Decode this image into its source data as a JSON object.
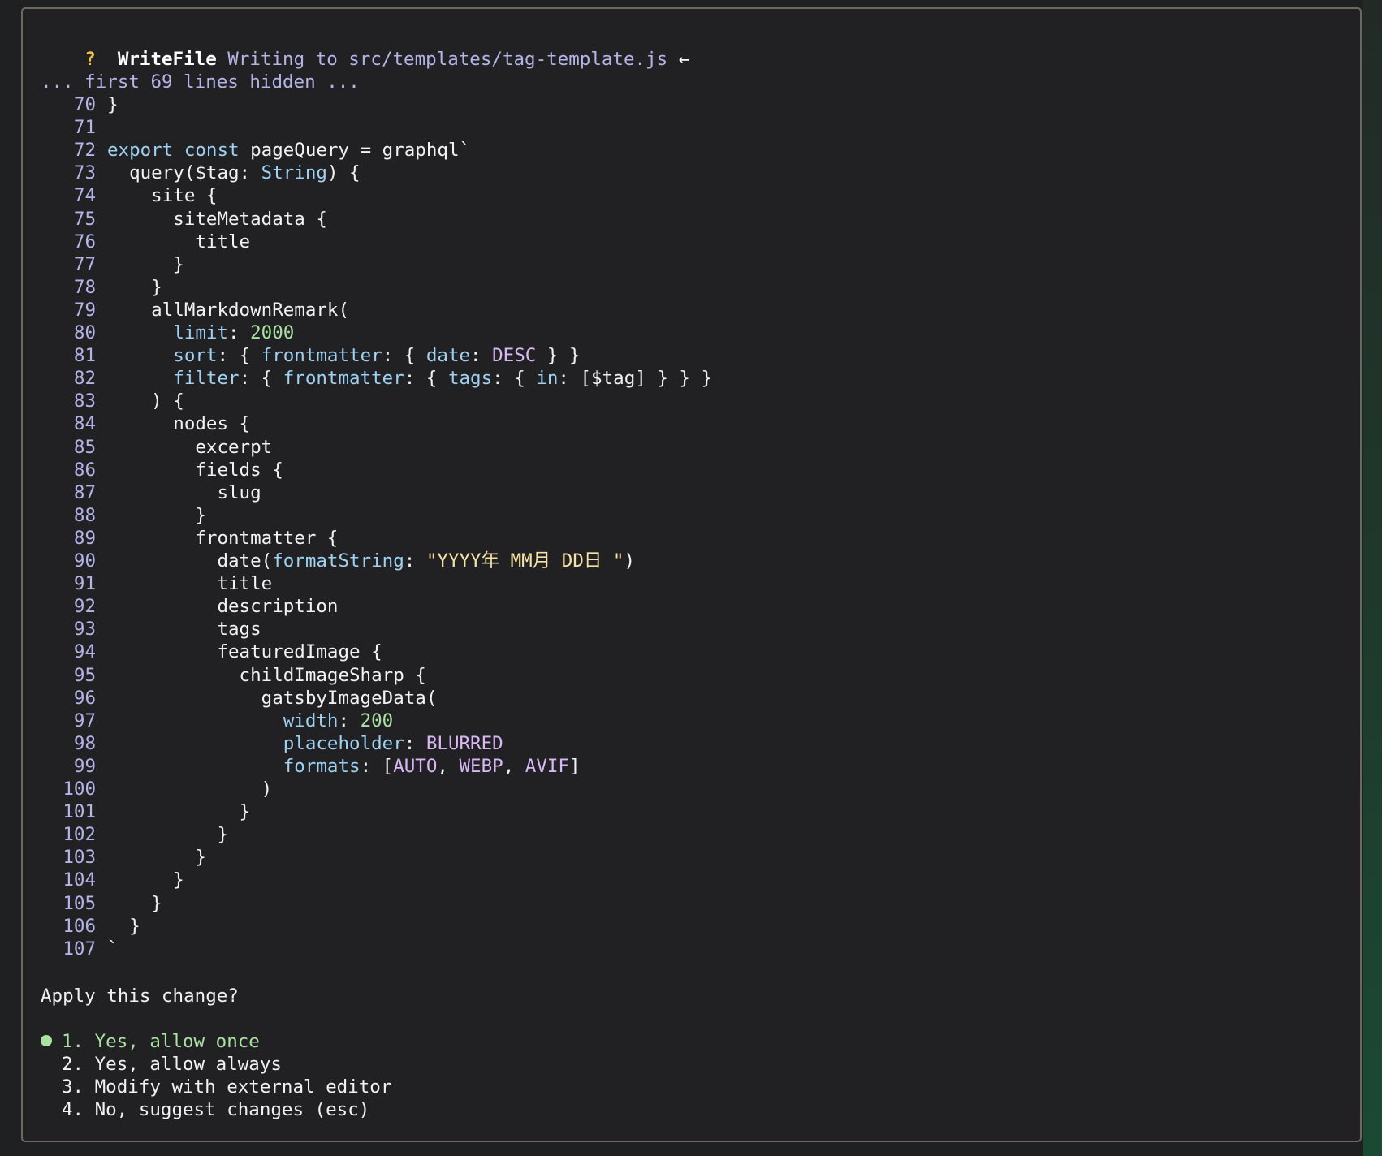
{
  "header": {
    "question_mark": "?",
    "tool_name": "WriteFile",
    "description": "Writing to src/templates/tag-template.js",
    "arrow": "←"
  },
  "hidden_note": "... first 69 lines hidden ...",
  "code": {
    "lines": [
      {
        "n": "70",
        "tokens": [
          {
            "t": "}",
            "c": "default"
          }
        ]
      },
      {
        "n": "71",
        "tokens": []
      },
      {
        "n": "72",
        "tokens": [
          {
            "t": "export const ",
            "c": "kw"
          },
          {
            "t": "pageQuery = graphql`",
            "c": "default"
          }
        ]
      },
      {
        "n": "73",
        "tokens": [
          {
            "t": "  query($tag: ",
            "c": "default"
          },
          {
            "t": "String",
            "c": "type"
          },
          {
            "t": ") {",
            "c": "default"
          }
        ]
      },
      {
        "n": "74",
        "tokens": [
          {
            "t": "    site {",
            "c": "default"
          }
        ]
      },
      {
        "n": "75",
        "tokens": [
          {
            "t": "      siteMetadata {",
            "c": "default"
          }
        ]
      },
      {
        "n": "76",
        "tokens": [
          {
            "t": "        title",
            "c": "default"
          }
        ]
      },
      {
        "n": "77",
        "tokens": [
          {
            "t": "      }",
            "c": "default"
          }
        ]
      },
      {
        "n": "78",
        "tokens": [
          {
            "t": "    }",
            "c": "default"
          }
        ]
      },
      {
        "n": "79",
        "tokens": [
          {
            "t": "    allMarkdownRemark(",
            "c": "default"
          }
        ]
      },
      {
        "n": "80",
        "tokens": [
          {
            "t": "      ",
            "c": "default"
          },
          {
            "t": "limit",
            "c": "prop"
          },
          {
            "t": ": ",
            "c": "default"
          },
          {
            "t": "2000",
            "c": "num"
          }
        ]
      },
      {
        "n": "81",
        "tokens": [
          {
            "t": "      ",
            "c": "default"
          },
          {
            "t": "sort",
            "c": "prop"
          },
          {
            "t": ": { ",
            "c": "default"
          },
          {
            "t": "frontmatter",
            "c": "prop"
          },
          {
            "t": ": { ",
            "c": "default"
          },
          {
            "t": "date",
            "c": "prop"
          },
          {
            "t": ": ",
            "c": "default"
          },
          {
            "t": "DESC",
            "c": "enum"
          },
          {
            "t": " } }",
            "c": "default"
          }
        ]
      },
      {
        "n": "82",
        "tokens": [
          {
            "t": "      ",
            "c": "default"
          },
          {
            "t": "filter",
            "c": "prop"
          },
          {
            "t": ": { ",
            "c": "default"
          },
          {
            "t": "frontmatter",
            "c": "prop"
          },
          {
            "t": ": { ",
            "c": "default"
          },
          {
            "t": "tags",
            "c": "prop"
          },
          {
            "t": ": { ",
            "c": "default"
          },
          {
            "t": "in",
            "c": "prop"
          },
          {
            "t": ": [$tag] } } }",
            "c": "default"
          }
        ]
      },
      {
        "n": "83",
        "tokens": [
          {
            "t": "    ) {",
            "c": "default"
          }
        ]
      },
      {
        "n": "84",
        "tokens": [
          {
            "t": "      nodes {",
            "c": "default"
          }
        ]
      },
      {
        "n": "85",
        "tokens": [
          {
            "t": "        excerpt",
            "c": "default"
          }
        ]
      },
      {
        "n": "86",
        "tokens": [
          {
            "t": "        fields {",
            "c": "default"
          }
        ]
      },
      {
        "n": "87",
        "tokens": [
          {
            "t": "          slug",
            "c": "default"
          }
        ]
      },
      {
        "n": "88",
        "tokens": [
          {
            "t": "        }",
            "c": "default"
          }
        ]
      },
      {
        "n": "89",
        "tokens": [
          {
            "t": "        frontmatter {",
            "c": "default"
          }
        ]
      },
      {
        "n": "90",
        "tokens": [
          {
            "t": "          date(",
            "c": "default"
          },
          {
            "t": "formatString",
            "c": "prop"
          },
          {
            "t": ": ",
            "c": "default"
          },
          {
            "t": "\"YYYY年 MM月 DD日 \"",
            "c": "str"
          },
          {
            "t": ")",
            "c": "default"
          }
        ]
      },
      {
        "n": "91",
        "tokens": [
          {
            "t": "          title",
            "c": "default"
          }
        ]
      },
      {
        "n": "92",
        "tokens": [
          {
            "t": "          description",
            "c": "default"
          }
        ]
      },
      {
        "n": "93",
        "tokens": [
          {
            "t": "          tags",
            "c": "default"
          }
        ]
      },
      {
        "n": "94",
        "tokens": [
          {
            "t": "          featuredImage {",
            "c": "default"
          }
        ]
      },
      {
        "n": "95",
        "tokens": [
          {
            "t": "            childImageSharp {",
            "c": "default"
          }
        ]
      },
      {
        "n": "96",
        "tokens": [
          {
            "t": "              gatsbyImageData(",
            "c": "default"
          }
        ]
      },
      {
        "n": "97",
        "tokens": [
          {
            "t": "                ",
            "c": "default"
          },
          {
            "t": "width",
            "c": "prop"
          },
          {
            "t": ": ",
            "c": "default"
          },
          {
            "t": "200",
            "c": "num"
          }
        ]
      },
      {
        "n": "98",
        "tokens": [
          {
            "t": "                ",
            "c": "default"
          },
          {
            "t": "placeholder",
            "c": "prop"
          },
          {
            "t": ": ",
            "c": "default"
          },
          {
            "t": "BLURRED",
            "c": "enum"
          }
        ]
      },
      {
        "n": "99",
        "tokens": [
          {
            "t": "                ",
            "c": "default"
          },
          {
            "t": "formats",
            "c": "prop"
          },
          {
            "t": ": [",
            "c": "default"
          },
          {
            "t": "AUTO",
            "c": "enum"
          },
          {
            "t": ", ",
            "c": "default"
          },
          {
            "t": "WEBP",
            "c": "enum"
          },
          {
            "t": ", ",
            "c": "default"
          },
          {
            "t": "AVIF",
            "c": "enum"
          },
          {
            "t": "]",
            "c": "default"
          }
        ]
      },
      {
        "n": "100",
        "tokens": [
          {
            "t": "              )",
            "c": "default"
          }
        ]
      },
      {
        "n": "101",
        "tokens": [
          {
            "t": "            }",
            "c": "default"
          }
        ]
      },
      {
        "n": "102",
        "tokens": [
          {
            "t": "          }",
            "c": "default"
          }
        ]
      },
      {
        "n": "103",
        "tokens": [
          {
            "t": "        }",
            "c": "default"
          }
        ]
      },
      {
        "n": "104",
        "tokens": [
          {
            "t": "      }",
            "c": "default"
          }
        ]
      },
      {
        "n": "105",
        "tokens": [
          {
            "t": "    }",
            "c": "default"
          }
        ]
      },
      {
        "n": "106",
        "tokens": [
          {
            "t": "  }",
            "c": "default"
          }
        ]
      },
      {
        "n": "107",
        "tokens": [
          {
            "t": "`",
            "c": "default"
          }
        ]
      }
    ]
  },
  "prompt": {
    "question": "Apply this change?",
    "options": [
      {
        "label": "1. Yes, allow once",
        "selected": true
      },
      {
        "label": "2. Yes, allow always",
        "selected": false
      },
      {
        "label": "3. Modify with external editor",
        "selected": false
      },
      {
        "label": "4. No, suggest changes (esc)",
        "selected": false
      }
    ]
  },
  "colors": {
    "background": "#212123",
    "border": "#6c6a60",
    "dim_text": "#b4b4e8",
    "keyword": "#9fd2f2",
    "number": "#a9e2a2",
    "enum": "#d9b7f5",
    "string": "#f6e1a6",
    "selected_option": "#a9e2a2",
    "question_mark": "#f0c14b"
  }
}
